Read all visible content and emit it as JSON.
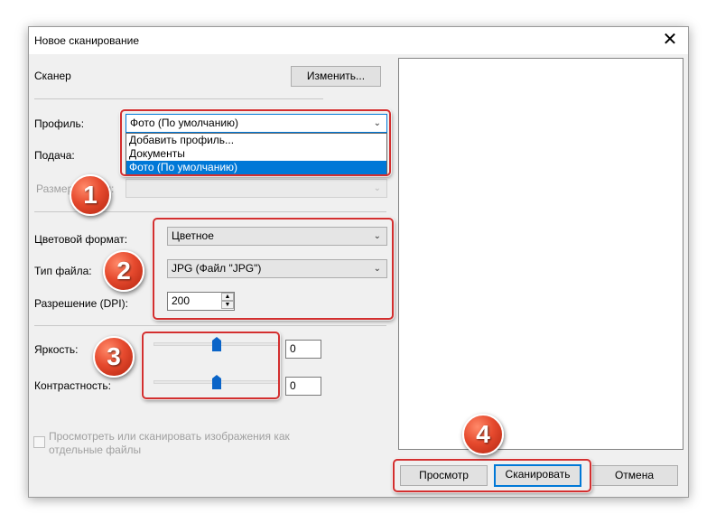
{
  "window": {
    "title": "Новое сканирование",
    "close_glyph": "✕"
  },
  "scanner": {
    "label": "Сканер",
    "change_button": "Изменить..."
  },
  "profile": {
    "label": "Профиль:",
    "value": "Фото (По умолчанию)",
    "options": [
      "Добавить профиль...",
      "Документы",
      "Фото (По умолчанию)"
    ]
  },
  "source": {
    "label": "Подача:"
  },
  "paper_size": {
    "label": "Размер бумаги:"
  },
  "color_format": {
    "label": "Цветовой формат:",
    "value": "Цветное"
  },
  "file_type": {
    "label": "Тип файла:",
    "value": "JPG (Файл \"JPG\")"
  },
  "resolution": {
    "label": "Разрешение (DPI):",
    "value": "200"
  },
  "brightness": {
    "label": "Яркость:",
    "value": "0",
    "level": 0.5
  },
  "contrast": {
    "label": "Контрастность:",
    "value": "0",
    "level": 0.5
  },
  "separate_files": {
    "label_line1": "Просмотреть или сканировать изображения как",
    "label_line2": "отдельные файлы",
    "checked": false
  },
  "buttons": {
    "preview": "Просмотр",
    "scan": "Сканировать",
    "cancel": "Отмена"
  },
  "annotations": [
    "1",
    "2",
    "3",
    "4"
  ],
  "colors": {
    "highlight": "#d32f2f",
    "badge": "#e64a2e",
    "selection": "#0078d7"
  }
}
